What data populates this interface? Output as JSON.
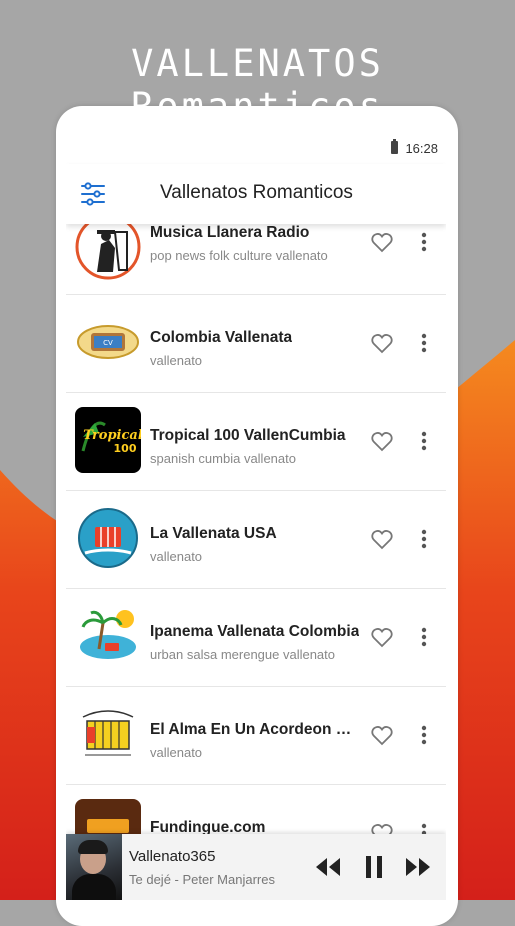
{
  "promo": {
    "title": "VALLENATOS Romanticos"
  },
  "statusbar": {
    "time": "16:28",
    "battery_icon": "battery-icon"
  },
  "appbar": {
    "menu_icon": "equalizer-menu-icon",
    "title": "Vallenatos Romanticos"
  },
  "stations": [
    {
      "name": "Musica Llanera Radio",
      "tags": "pop news folk culture vallenato",
      "logo": "harp-player-logo"
    },
    {
      "name": "Colombia Vallenata",
      "tags": "vallenato",
      "logo": "colombia-vallenata-logo"
    },
    {
      "name": "Tropical 100 VallenCumbia",
      "tags": "spanish cumbia vallenato",
      "logo": "tropical-100-logo"
    },
    {
      "name": "La Vallenata USA",
      "tags": "vallenato",
      "logo": "accordion-globe-logo"
    },
    {
      "name": "Ipanema Vallenata Colombia",
      "tags": "urban salsa merengue vallenato",
      "logo": "beach-palm-logo"
    },
    {
      "name": "El Alma En Un Acordeon Em…",
      "tags": "vallenato",
      "logo": "accordion-logo"
    },
    {
      "name": "Fundingue.com",
      "tags": "",
      "logo": "fundingue-logo"
    }
  ],
  "player": {
    "station": "Vallenato365",
    "track": "Te dejé - Peter Manjarres",
    "controls": [
      "rewind-icon",
      "pause-icon",
      "fast-forward-icon"
    ]
  },
  "colors": {
    "accent_orange": "#f07a1a",
    "accent_red": "#d9231b",
    "bg_gray": "#a6a6a6"
  }
}
